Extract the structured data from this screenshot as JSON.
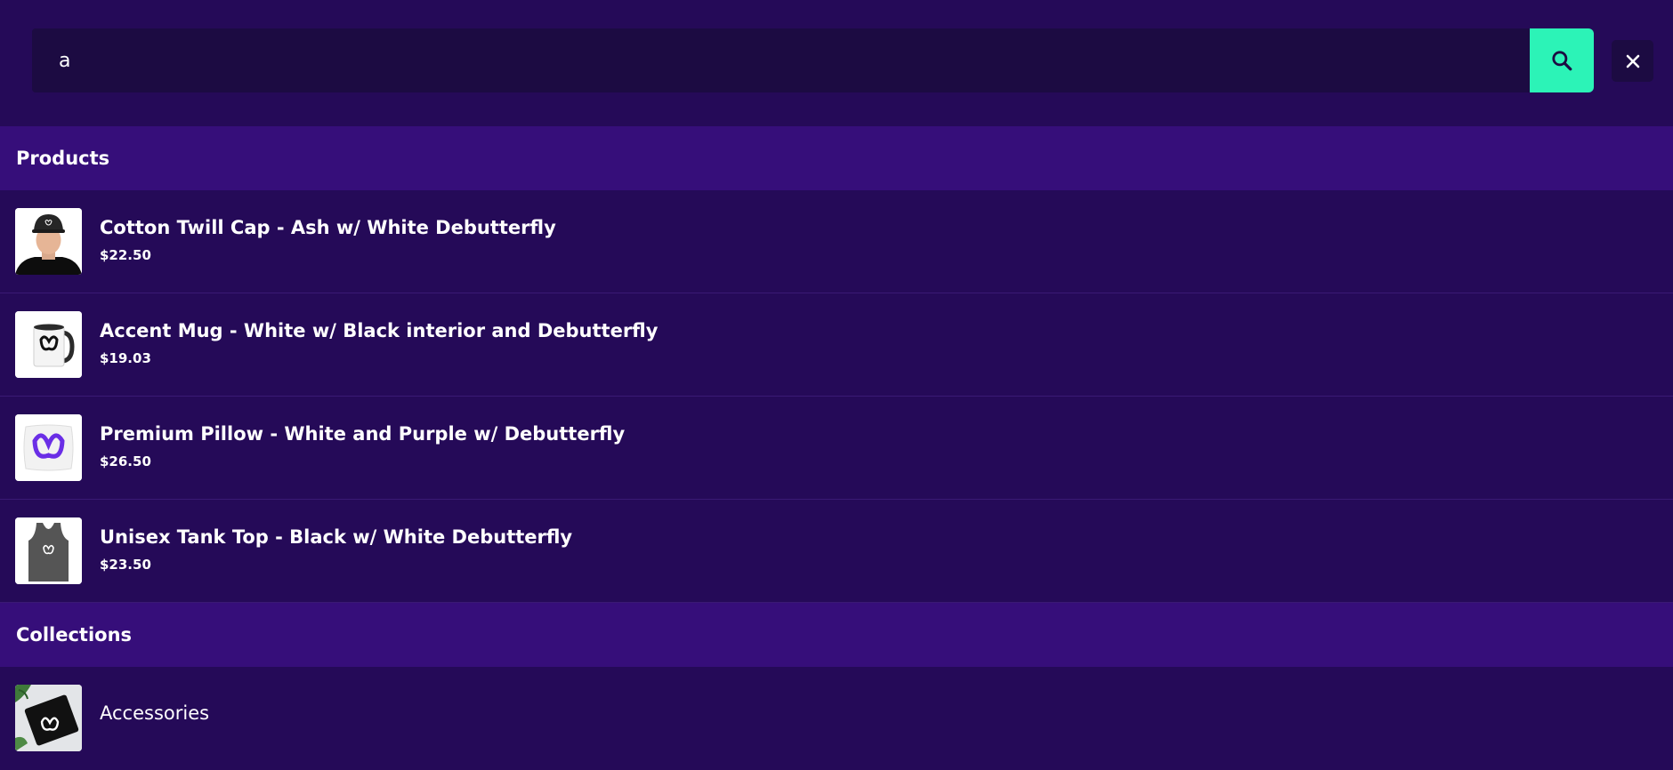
{
  "search": {
    "value": "a",
    "search_icon": "search-icon",
    "close_icon": "close-icon"
  },
  "sections": {
    "products": {
      "heading": "Products",
      "items": [
        {
          "title": "Cotton Twill Cap - Ash w/ White Debutterfly",
          "price": "$22.50",
          "thumb_icon": "cap-photo"
        },
        {
          "title": "Accent Mug - White w/ Black interior and Debutterfly",
          "price": "$19.03",
          "thumb_icon": "mug-photo"
        },
        {
          "title": "Premium Pillow - White and Purple w/ Debutterfly",
          "price": "$26.50",
          "thumb_icon": "pillow-photo"
        },
        {
          "title": "Unisex Tank Top - Black w/ White Debutterfly",
          "price": "$23.50",
          "thumb_icon": "tank-top-photo"
        }
      ]
    },
    "collections": {
      "heading": "Collections",
      "items": [
        {
          "title": "Accessories",
          "thumb_icon": "accessories-photo"
        }
      ]
    }
  },
  "colors": {
    "background": "#250a58",
    "section_header": "#360e7a",
    "input_background": "#1c0b42",
    "accent": "#2cf3b7"
  }
}
